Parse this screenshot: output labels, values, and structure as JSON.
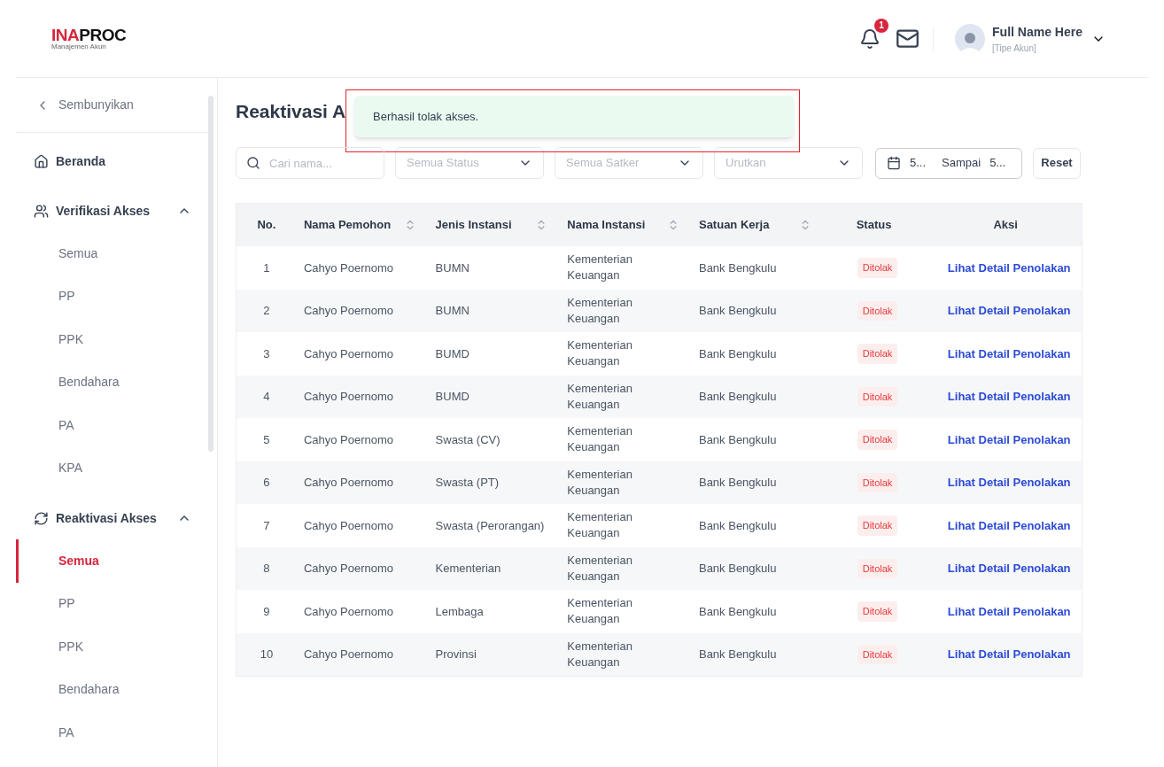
{
  "header": {
    "logo": {
      "part_red": "INA",
      "part_dark": "PROC",
      "subtitle": "Manajemen Akun"
    },
    "notification_count": "1",
    "user": {
      "name": "Full Name Here",
      "role": "[Tipe Akun]"
    }
  },
  "sidebar": {
    "collapse_label": "Sembunyikan",
    "items": [
      {
        "label": "Beranda"
      },
      {
        "label": "Verifikasi Akses",
        "expanded": true,
        "children": [
          {
            "label": "Semua",
            "selected": false
          },
          {
            "label": "PP",
            "selected": false
          },
          {
            "label": "PPK",
            "selected": false
          },
          {
            "label": "Bendahara",
            "selected": false
          },
          {
            "label": "PA",
            "selected": false
          },
          {
            "label": "KPA",
            "selected": false
          }
        ]
      },
      {
        "label": "Reaktivasi Akses",
        "expanded": true,
        "children": [
          {
            "label": "Semua",
            "selected": true
          },
          {
            "label": "PP",
            "selected": false
          },
          {
            "label": "PPK",
            "selected": false
          },
          {
            "label": "Bendahara",
            "selected": false
          },
          {
            "label": "PA",
            "selected": false
          }
        ]
      }
    ]
  },
  "page": {
    "title": "Reaktivasi A",
    "toast": {
      "message": "Berhasil tolak akses.",
      "highlighted": true
    }
  },
  "filters": {
    "search_placeholder": "Cari nama...",
    "status_placeholder": "Semua Status",
    "satker_placeholder": "Semua Satker",
    "sort_placeholder": "Urutkan",
    "date_from": "5...",
    "date_separator": "Sampai",
    "date_to": "5...",
    "reset": "Reset"
  },
  "table": {
    "columns": [
      {
        "label": "No.",
        "sortable": false
      },
      {
        "label": "Nama Pemohon",
        "sortable": true
      },
      {
        "label": "Jenis Instansi",
        "sortable": true
      },
      {
        "label": "Nama Instansi",
        "sortable": true
      },
      {
        "label": "Satuan Kerja",
        "sortable": true
      },
      {
        "label": "Status",
        "sortable": false
      },
      {
        "label": "Aksi",
        "sortable": false
      }
    ],
    "rows": [
      {
        "no": "1",
        "name": "Cahyo Poernomo",
        "type": "BUMN",
        "instansi": "Kementerian Keuangan",
        "satker": "Bank Bengkulu",
        "status": "Ditolak",
        "action": "Lihat Detail Penolakan"
      },
      {
        "no": "2",
        "name": "Cahyo Poernomo",
        "type": "BUMN",
        "instansi": "Kementerian Keuangan",
        "satker": "Bank Bengkulu",
        "status": "Ditolak",
        "action": "Lihat Detail Penolakan"
      },
      {
        "no": "3",
        "name": "Cahyo Poernomo",
        "type": "BUMD",
        "instansi": "Kementerian Keuangan",
        "satker": "Bank Bengkulu",
        "status": "Ditolak",
        "action": "Lihat Detail Penolakan"
      },
      {
        "no": "4",
        "name": "Cahyo Poernomo",
        "type": "BUMD",
        "instansi": "Kementerian Keuangan",
        "satker": "Bank Bengkulu",
        "status": "Ditolak",
        "action": "Lihat Detail Penolakan"
      },
      {
        "no": "5",
        "name": "Cahyo Poernomo",
        "type": "Swasta (CV)",
        "instansi": "Kementerian Keuangan",
        "satker": "Bank Bengkulu",
        "status": "Ditolak",
        "action": "Lihat Detail Penolakan"
      },
      {
        "no": "6",
        "name": "Cahyo Poernomo",
        "type": "Swasta (PT)",
        "instansi": "Kementerian Keuangan",
        "satker": "Bank Bengkulu",
        "status": "Ditolak",
        "action": "Lihat Detail Penolakan"
      },
      {
        "no": "7",
        "name": "Cahyo Poernomo",
        "type": "Swasta (Perorangan)",
        "instansi": "Kementerian Keuangan",
        "satker": "Bank Bengkulu",
        "status": "Ditolak",
        "action": "Lihat Detail Penolakan"
      },
      {
        "no": "8",
        "name": "Cahyo Poernomo",
        "type": "Kementerian",
        "instansi": "Kementerian Keuangan",
        "satker": "Bank Bengkulu",
        "status": "Ditolak",
        "action": "Lihat Detail Penolakan"
      },
      {
        "no": "9",
        "name": "Cahyo Poernomo",
        "type": "Lembaga",
        "instansi": "Kementerian Keuangan",
        "satker": "Bank Bengkulu",
        "status": "Ditolak",
        "action": "Lihat Detail Penolakan"
      },
      {
        "no": "10",
        "name": "Cahyo Poernomo",
        "type": "Provinsi",
        "instansi": "Kementerian Keuangan",
        "satker": "Bank Bengkulu",
        "status": "Ditolak",
        "action": "Lihat Detail Penolakan"
      }
    ]
  }
}
